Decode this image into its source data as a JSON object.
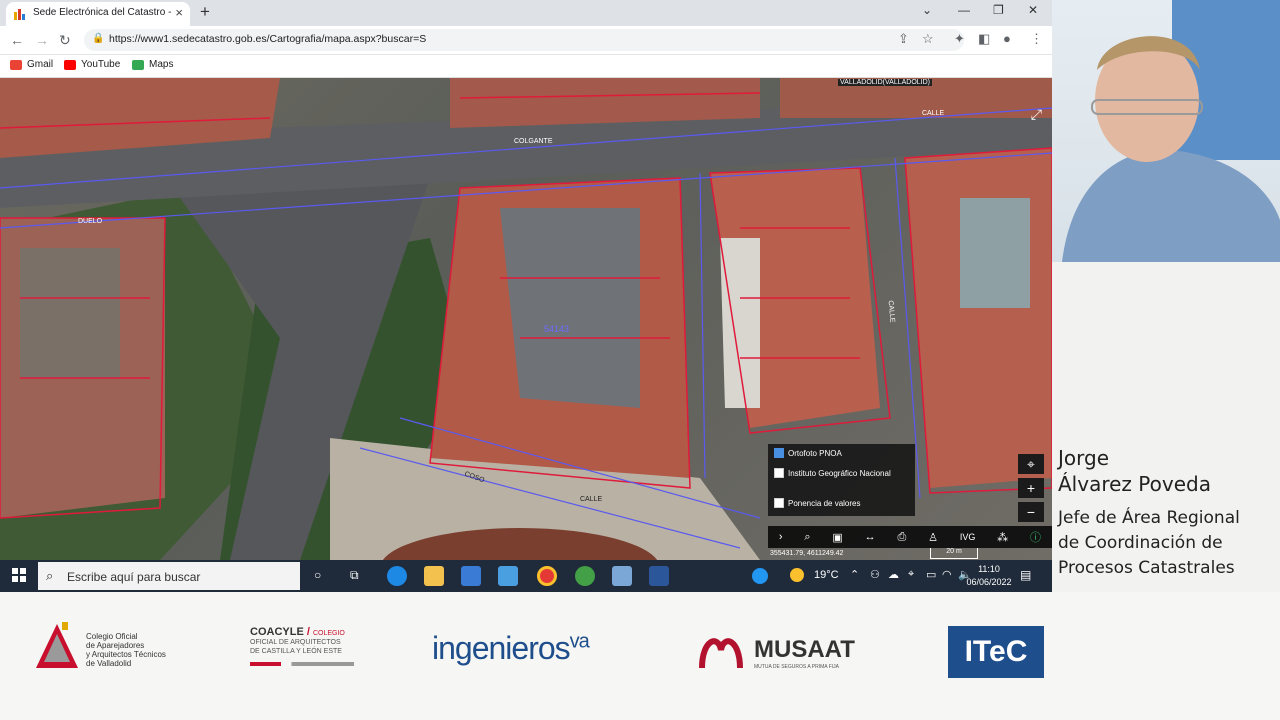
{
  "browser": {
    "tab_title": "Sede Electrónica del Catastro - F",
    "url": "https://www1.sedecatastro.gob.es/Cartografia/mapa.aspx?buscar=S",
    "bookmarks": [
      "Gmail",
      "YouTube",
      "Maps"
    ]
  },
  "map": {
    "labels": {
      "city": "VALLADOLID(VALLADOLID)",
      "street_colgante": "COLGANTE",
      "street_calle_top": "CALLE",
      "street_calle_right": "CALLE",
      "parcel_ref": "54143",
      "plaza_coso": "COSO",
      "calle_bottom": "CALLE",
      "duelo": "DUELO"
    },
    "layers": [
      {
        "label": "Ortofoto PNOA",
        "checked": true
      },
      {
        "label": "Instituto Geográfico Nacional",
        "checked": false
      },
      {
        "label": "Ponencia de valores",
        "checked": false
      }
    ],
    "coordinates": "355431.79, 4611249.42",
    "scale": "20 m",
    "toolbar_ivg": "IVG"
  },
  "taskbar": {
    "search_placeholder": "Escribe aquí para buscar",
    "temperature": "19°C",
    "time": "11:10",
    "date": "06/06/2022"
  },
  "speaker": {
    "first_name": "Jorge",
    "last_name": "Álvarez Poveda",
    "role_line1": "Jefe de Área Regional",
    "role_line2": "de Coordinación de",
    "role_line3": "Procesos Catastrales"
  },
  "sponsors": {
    "colegio": [
      "Colegio Oficial",
      "de Aparejadores",
      "y Arquitectos Técnicos",
      "de Valladolid"
    ],
    "coacyle_title": "COACYLE",
    "coacyle_sub": [
      "COLEGIO",
      "OFICIAL DE ARQUITECTOS",
      "DE CASTILLA Y LEÓN ESTE"
    ],
    "ingenieros": "ingenieros",
    "ingenieros_sup": "va",
    "musaat": "MUSAAT",
    "musaat_sub": "MUTUA DE SEGUROS A PRIMA FIJA",
    "itec": "ITeC"
  },
  "colors": {
    "parcel_lines": "#e01a3a",
    "street_lines": "#5a5af0",
    "taskbar": "#1f2a3a",
    "itec_blue": "#1f4e8c",
    "ingenieros_blue": "#1f4e8c",
    "musaat_red": "#b3122e"
  }
}
